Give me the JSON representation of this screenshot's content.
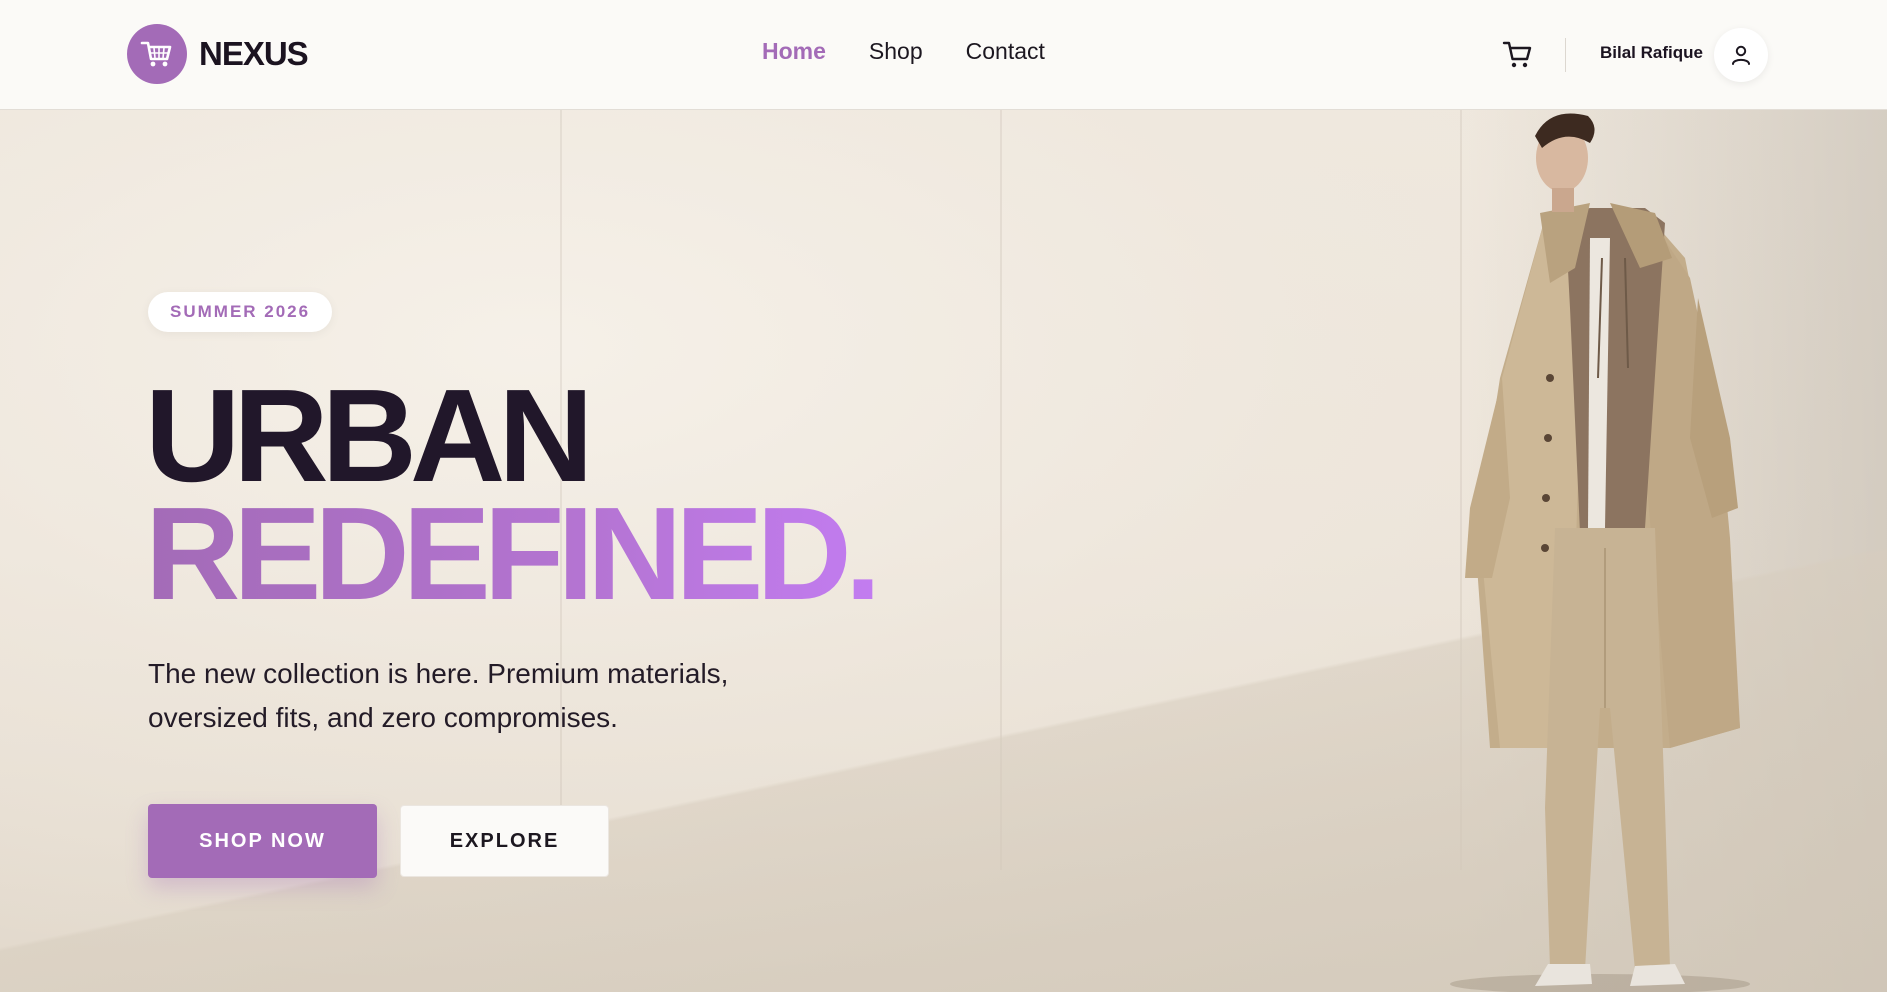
{
  "brand": {
    "name": "NEXUS",
    "accent_color": "#a36bb7",
    "logo_icon": "shopping-cart-icon"
  },
  "nav": {
    "links": [
      {
        "label": "Home",
        "active": true
      },
      {
        "label": "Shop",
        "active": false
      },
      {
        "label": "Contact",
        "active": false
      }
    ]
  },
  "header": {
    "cart_icon": "cart-icon",
    "user_name": "Bilal Rafique",
    "user_icon": "user-icon"
  },
  "hero": {
    "badge": "SUMMER 2026",
    "headline_line1": "URBAN",
    "headline_line2": "REDEFINED.",
    "subtitle_line1": "The new collection is here. Premium materials,",
    "subtitle_line2": "oversized fits, and zero compromises.",
    "primary_button": "SHOP NOW",
    "secondary_button": "EXPLORE",
    "headline_color": "#21172a",
    "gradient_end_color": "#c27cf0"
  }
}
